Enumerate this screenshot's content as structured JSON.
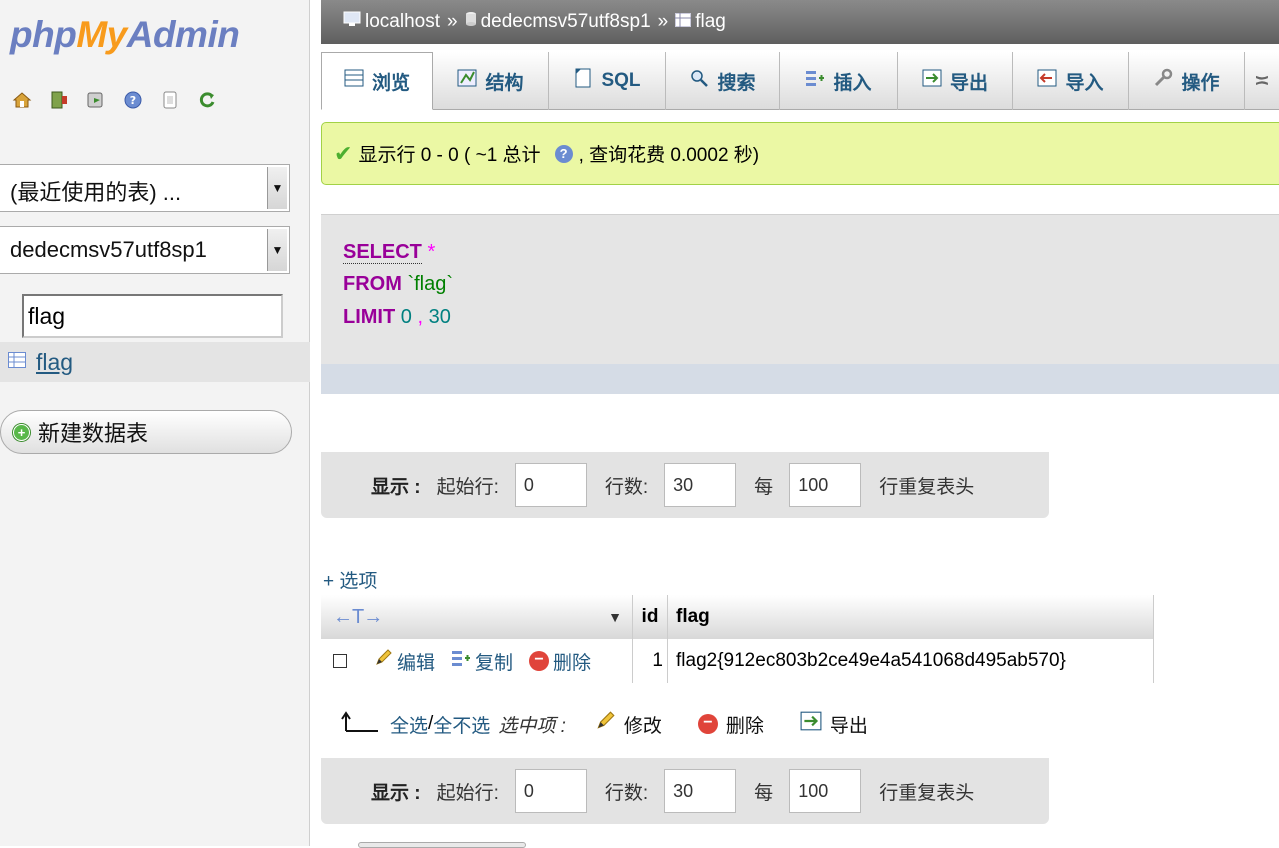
{
  "logo": {
    "php": "php",
    "my": "My",
    "admin": "Admin"
  },
  "sidebar": {
    "nav_icons": [
      "home-icon",
      "exit-icon",
      "sql-query-icon",
      "help-icon",
      "docs-icon",
      "reload-icon"
    ],
    "recent_tables": "(最近使用的表) ...",
    "database": "dedecmsv57utf8sp1",
    "filter_value": "flag",
    "table_name": "flag",
    "new_table": "新建数据表"
  },
  "breadcrumb": {
    "server": "localhost",
    "sep": "»",
    "database": "dedecmsv57utf8sp1",
    "table": "flag"
  },
  "tabs": [
    {
      "label": "浏览",
      "icon": "browse-icon"
    },
    {
      "label": "结构",
      "icon": "structure-icon"
    },
    {
      "label": "SQL",
      "icon": "sql-icon"
    },
    {
      "label": "搜索",
      "icon": "search-icon"
    },
    {
      "label": "插入",
      "icon": "insert-icon"
    },
    {
      "label": "导出",
      "icon": "export-icon"
    },
    {
      "label": "导入",
      "icon": "import-icon"
    },
    {
      "label": "操作",
      "icon": "wrench-icon"
    }
  ],
  "message": {
    "text_before": "显示行 0 - 0 ( ~1 总计",
    "text_after": ", 查询花费 0.0002 秒)"
  },
  "sql": {
    "select": "SELECT",
    "star": "*",
    "from": "FROM",
    "table": "`flag`",
    "limit": "LIMIT",
    "offset": "0",
    "comma": ",",
    "count": "30"
  },
  "navigation": {
    "show_label": "显示 :",
    "start_label": "起始行:",
    "start_value": "0",
    "rows_label": "行数:",
    "rows_value": "30",
    "per_label": "每",
    "per_value": "100",
    "repeat_label": "行重复表头"
  },
  "options_link": "+ 选项",
  "table": {
    "arrows": "←T→",
    "columns": [
      "id",
      "flag"
    ],
    "rows": [
      {
        "edit": "编辑",
        "copy": "复制",
        "delete": "删除",
        "id": "1",
        "flag": "flag2{912ec803b2ce49e4a541068d495ab570}"
      }
    ]
  },
  "bulk": {
    "check_all": "全选",
    "slash": " / ",
    "uncheck_all": "全不选",
    "selected_label": "选中项 :",
    "modify": "修改",
    "delete": "删除",
    "export": "导出"
  }
}
